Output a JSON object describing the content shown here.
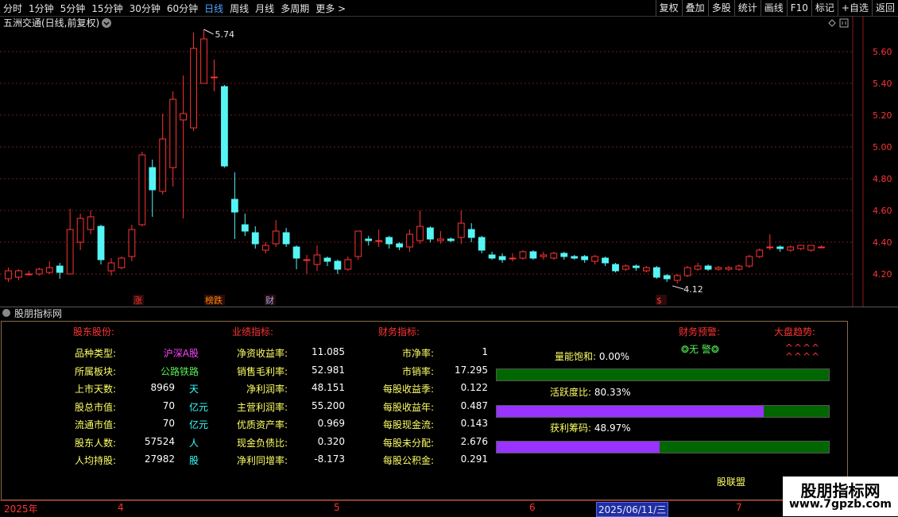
{
  "toolbar": {
    "periods": [
      "分时",
      "1分钟",
      "5分钟",
      "15分钟",
      "30分钟",
      "60分钟",
      "日线",
      "周线",
      "月线",
      "多周期",
      "更多 >"
    ],
    "active_period": "日线",
    "right_buttons": [
      "复权",
      "叠加",
      "多股",
      "统计",
      "画线",
      "F10",
      "标记",
      "+自选",
      "返回"
    ]
  },
  "chart_header": {
    "title": "五洲交通(日线,前复权)"
  },
  "chart_data": {
    "type": "candlestick",
    "ylim": [
      4.1,
      5.8
    ],
    "y_ticks": [
      "5.60",
      "5.40",
      "5.20",
      "5.00",
      "4.80",
      "4.60",
      "4.40",
      "4.20"
    ],
    "high_label": "5.74",
    "low_label": "4.12",
    "markers": [
      "涨",
      "榜跌",
      "财",
      "$"
    ],
    "candles": [
      {
        "o": 4.17,
        "c": 4.22,
        "h": 4.24,
        "l": 4.15
      },
      {
        "o": 4.18,
        "c": 4.22,
        "h": 4.23,
        "l": 4.16
      },
      {
        "o": 4.2,
        "c": 4.2,
        "h": 4.22,
        "l": 4.19
      },
      {
        "o": 4.2,
        "c": 4.23,
        "h": 4.24,
        "l": 4.19
      },
      {
        "o": 4.21,
        "c": 4.24,
        "h": 4.28,
        "l": 4.2
      },
      {
        "o": 4.25,
        "c": 4.21,
        "h": 4.27,
        "l": 4.17
      },
      {
        "o": 4.2,
        "c": 4.48,
        "h": 4.61,
        "l": 4.2
      },
      {
        "o": 4.4,
        "c": 4.55,
        "h": 4.58,
        "l": 4.35
      },
      {
        "o": 4.48,
        "c": 4.56,
        "h": 4.6,
        "l": 4.45
      },
      {
        "o": 4.5,
        "c": 4.29,
        "h": 4.51,
        "l": 4.26
      },
      {
        "o": 4.22,
        "c": 4.27,
        "h": 4.3,
        "l": 4.19
      },
      {
        "o": 4.24,
        "c": 4.3,
        "h": 4.31,
        "l": 4.23
      },
      {
        "o": 4.31,
        "c": 4.48,
        "h": 4.51,
        "l": 4.28
      },
      {
        "o": 4.51,
        "c": 4.95,
        "h": 4.97,
        "l": 4.5
      },
      {
        "o": 4.87,
        "c": 4.73,
        "h": 4.92,
        "l": 4.56
      },
      {
        "o": 4.72,
        "c": 5.05,
        "h": 5.21,
        "l": 4.7
      },
      {
        "o": 4.87,
        "c": 5.3,
        "h": 5.35,
        "l": 4.75
      },
      {
        "o": 5.17,
        "c": 5.21,
        "h": 5.45,
        "l": 4.55
      },
      {
        "o": 5.12,
        "c": 5.62,
        "h": 5.72,
        "l": 5.1
      },
      {
        "o": 5.4,
        "c": 5.68,
        "h": 5.74,
        "l": 5.4
      },
      {
        "o": 5.44,
        "c": 5.44,
        "h": 5.55,
        "l": 5.35
      },
      {
        "o": 5.38,
        "c": 4.88,
        "h": 5.39,
        "l": 4.87
      },
      {
        "o": 4.67,
        "c": 4.59,
        "h": 4.84,
        "l": 4.42
      },
      {
        "o": 4.51,
        "c": 4.47,
        "h": 4.58,
        "l": 4.44
      },
      {
        "o": 4.46,
        "c": 4.39,
        "h": 4.5,
        "l": 4.36
      },
      {
        "o": 4.35,
        "c": 4.38,
        "h": 4.4,
        "l": 4.33
      },
      {
        "o": 4.39,
        "c": 4.47,
        "h": 4.54,
        "l": 4.37
      },
      {
        "o": 4.46,
        "c": 4.39,
        "h": 4.49,
        "l": 4.37
      },
      {
        "o": 4.37,
        "c": 4.3,
        "h": 4.38,
        "l": 4.23
      },
      {
        "o": 4.29,
        "c": 4.29,
        "h": 4.32,
        "l": 4.2
      },
      {
        "o": 4.26,
        "c": 4.32,
        "h": 4.38,
        "l": 4.22
      },
      {
        "o": 4.3,
        "c": 4.28,
        "h": 4.31,
        "l": 4.25
      },
      {
        "o": 4.28,
        "c": 4.23,
        "h": 4.29,
        "l": 4.2
      },
      {
        "o": 4.23,
        "c": 4.29,
        "h": 4.31,
        "l": 4.22
      },
      {
        "o": 4.31,
        "c": 4.47,
        "h": 4.47,
        "l": 4.29
      },
      {
        "o": 4.42,
        "c": 4.41,
        "h": 4.44,
        "l": 4.38
      },
      {
        "o": 4.41,
        "c": 4.41,
        "h": 4.48,
        "l": 4.37
      },
      {
        "o": 4.43,
        "c": 4.39,
        "h": 4.44,
        "l": 4.36
      },
      {
        "o": 4.39,
        "c": 4.37,
        "h": 4.4,
        "l": 4.35
      },
      {
        "o": 4.37,
        "c": 4.45,
        "h": 4.48,
        "l": 4.34
      },
      {
        "o": 4.41,
        "c": 4.5,
        "h": 4.6,
        "l": 4.39
      },
      {
        "o": 4.49,
        "c": 4.42,
        "h": 4.5,
        "l": 4.4
      },
      {
        "o": 4.41,
        "c": 4.42,
        "h": 4.47,
        "l": 4.39
      },
      {
        "o": 4.42,
        "c": 4.41,
        "h": 4.43,
        "l": 4.4
      },
      {
        "o": 4.43,
        "c": 4.52,
        "h": 4.6,
        "l": 4.39
      },
      {
        "o": 4.48,
        "c": 4.43,
        "h": 4.52,
        "l": 4.4
      },
      {
        "o": 4.43,
        "c": 4.35,
        "h": 4.44,
        "l": 4.33
      },
      {
        "o": 4.32,
        "c": 4.3,
        "h": 4.34,
        "l": 4.29
      },
      {
        "o": 4.31,
        "c": 4.29,
        "h": 4.33,
        "l": 4.27
      },
      {
        "o": 4.3,
        "c": 4.3,
        "h": 4.33,
        "l": 4.28
      },
      {
        "o": 4.3,
        "c": 4.34,
        "h": 4.35,
        "l": 4.29
      },
      {
        "o": 4.34,
        "c": 4.3,
        "h": 4.35,
        "l": 4.29
      },
      {
        "o": 4.31,
        "c": 4.32,
        "h": 4.34,
        "l": 4.29
      },
      {
        "o": 4.3,
        "c": 4.33,
        "h": 4.34,
        "l": 4.29
      },
      {
        "o": 4.33,
        "c": 4.31,
        "h": 4.34,
        "l": 4.29
      },
      {
        "o": 4.31,
        "c": 4.3,
        "h": 4.32,
        "l": 4.29
      },
      {
        "o": 4.31,
        "c": 4.29,
        "h": 4.32,
        "l": 4.27
      },
      {
        "o": 4.28,
        "c": 4.31,
        "h": 4.32,
        "l": 4.26
      },
      {
        "o": 4.3,
        "c": 4.27,
        "h": 4.31,
        "l": 4.25
      },
      {
        "o": 4.26,
        "c": 4.22,
        "h": 4.27,
        "l": 4.21
      },
      {
        "o": 4.23,
        "c": 4.25,
        "h": 4.26,
        "l": 4.22
      },
      {
        "o": 4.25,
        "c": 4.24,
        "h": 4.26,
        "l": 4.22
      },
      {
        "o": 4.22,
        "c": 4.24,
        "h": 4.25,
        "l": 4.21
      },
      {
        "o": 4.24,
        "c": 4.18,
        "h": 4.25,
        "l": 4.17
      },
      {
        "o": 4.19,
        "c": 4.17,
        "h": 4.2,
        "l": 4.15
      },
      {
        "o": 4.16,
        "c": 4.19,
        "h": 4.2,
        "l": 4.14
      },
      {
        "o": 4.19,
        "c": 4.24,
        "h": 4.25,
        "l": 4.18
      },
      {
        "o": 4.23,
        "c": 4.25,
        "h": 4.27,
        "l": 4.22
      },
      {
        "o": 4.25,
        "c": 4.23,
        "h": 4.26,
        "l": 4.22
      },
      {
        "o": 4.23,
        "c": 4.24,
        "h": 4.25,
        "l": 4.22
      },
      {
        "o": 4.23,
        "c": 4.24,
        "h": 4.25,
        "l": 4.22
      },
      {
        "o": 4.23,
        "c": 4.25,
        "h": 4.26,
        "l": 4.22
      },
      {
        "o": 4.25,
        "c": 4.31,
        "h": 4.32,
        "l": 4.24
      },
      {
        "o": 4.31,
        "c": 4.35,
        "h": 4.36,
        "l": 4.3
      },
      {
        "o": 4.37,
        "c": 4.37,
        "h": 4.45,
        "l": 4.35
      },
      {
        "o": 4.37,
        "c": 4.36,
        "h": 4.38,
        "l": 4.34
      },
      {
        "o": 4.35,
        "c": 4.37,
        "h": 4.38,
        "l": 4.34
      },
      {
        "o": 4.36,
        "c": 4.38,
        "h": 4.38,
        "l": 4.35
      },
      {
        "o": 4.35,
        "c": 4.38,
        "h": 4.38,
        "l": 4.34
      },
      {
        "o": 4.37,
        "c": 4.37,
        "h": 4.38,
        "l": 4.37
      }
    ]
  },
  "panel": {
    "title": "股朋指标网",
    "sections": {
      "shareholder": "股东股份:",
      "performance": "业绩指标:",
      "finance": "财务指标:",
      "warning": "财务预警:",
      "market": "大盘趋势:"
    },
    "shareholder_rows": [
      {
        "label": "品种类型:",
        "value": "沪深A股",
        "unit": ""
      },
      {
        "label": "所属板块:",
        "value": "公路铁路",
        "unit": ""
      },
      {
        "label": "上市天数:",
        "value": "8969",
        "unit": "天"
      },
      {
        "label": "股总市值:",
        "value": "70",
        "unit": "亿元"
      },
      {
        "label": "流通市值:",
        "value": "70",
        "unit": "亿元"
      },
      {
        "label": "股东人数:",
        "value": "57524",
        "unit": "人"
      },
      {
        "label": "人均持股:",
        "value": "27982",
        "unit": "股"
      }
    ],
    "performance_rows": [
      {
        "label": "净资收益率:",
        "value": "11.085"
      },
      {
        "label": "销售毛利率:",
        "value": "52.981"
      },
      {
        "label": "净利润率:",
        "value": "48.151"
      },
      {
        "label": "主营利润率:",
        "value": "55.200"
      },
      {
        "label": "优质资产率:",
        "value": "0.969"
      },
      {
        "label": "现金负债比:",
        "value": "0.320"
      },
      {
        "label": "净利同增率:",
        "value": "-8.173"
      }
    ],
    "finance_rows": [
      {
        "label": "市净率:",
        "value": "1"
      },
      {
        "label": "市销率:",
        "value": "17.295"
      },
      {
        "label": "每股收益季:",
        "value": "0.122"
      },
      {
        "label": "每股收益年:",
        "value": "0.487"
      },
      {
        "label": "每股现金流:",
        "value": "0.143"
      },
      {
        "label": "每股未分配:",
        "value": "2.676"
      },
      {
        "label": "每股公积金:",
        "value": "0.291"
      }
    ],
    "warning_value": "❂无 警❂",
    "market_arrows": [
      "^^^^",
      "^^^^"
    ],
    "meters": [
      {
        "label": "量能饱和:",
        "value": "0.00%",
        "fraction": 0.0
      },
      {
        "label": "活跃度比:",
        "value": "80.33%",
        "fraction": 0.8033
      },
      {
        "label": "获利筹码:",
        "value": "48.97%",
        "fraction": 0.4897
      }
    ],
    "footer": "股联盟"
  },
  "date_axis": {
    "labels": [
      "2025年",
      "4",
      "5",
      "6",
      "2025/06/11/三",
      "7"
    ]
  },
  "watermark": {
    "line1": "股朋指标网",
    "line2": "www.7gpzb.com"
  },
  "colors": {
    "up": "#ff3333",
    "down": "#55f5f5",
    "grid": "#7a1a1a",
    "axis_text": "#ff3333"
  }
}
